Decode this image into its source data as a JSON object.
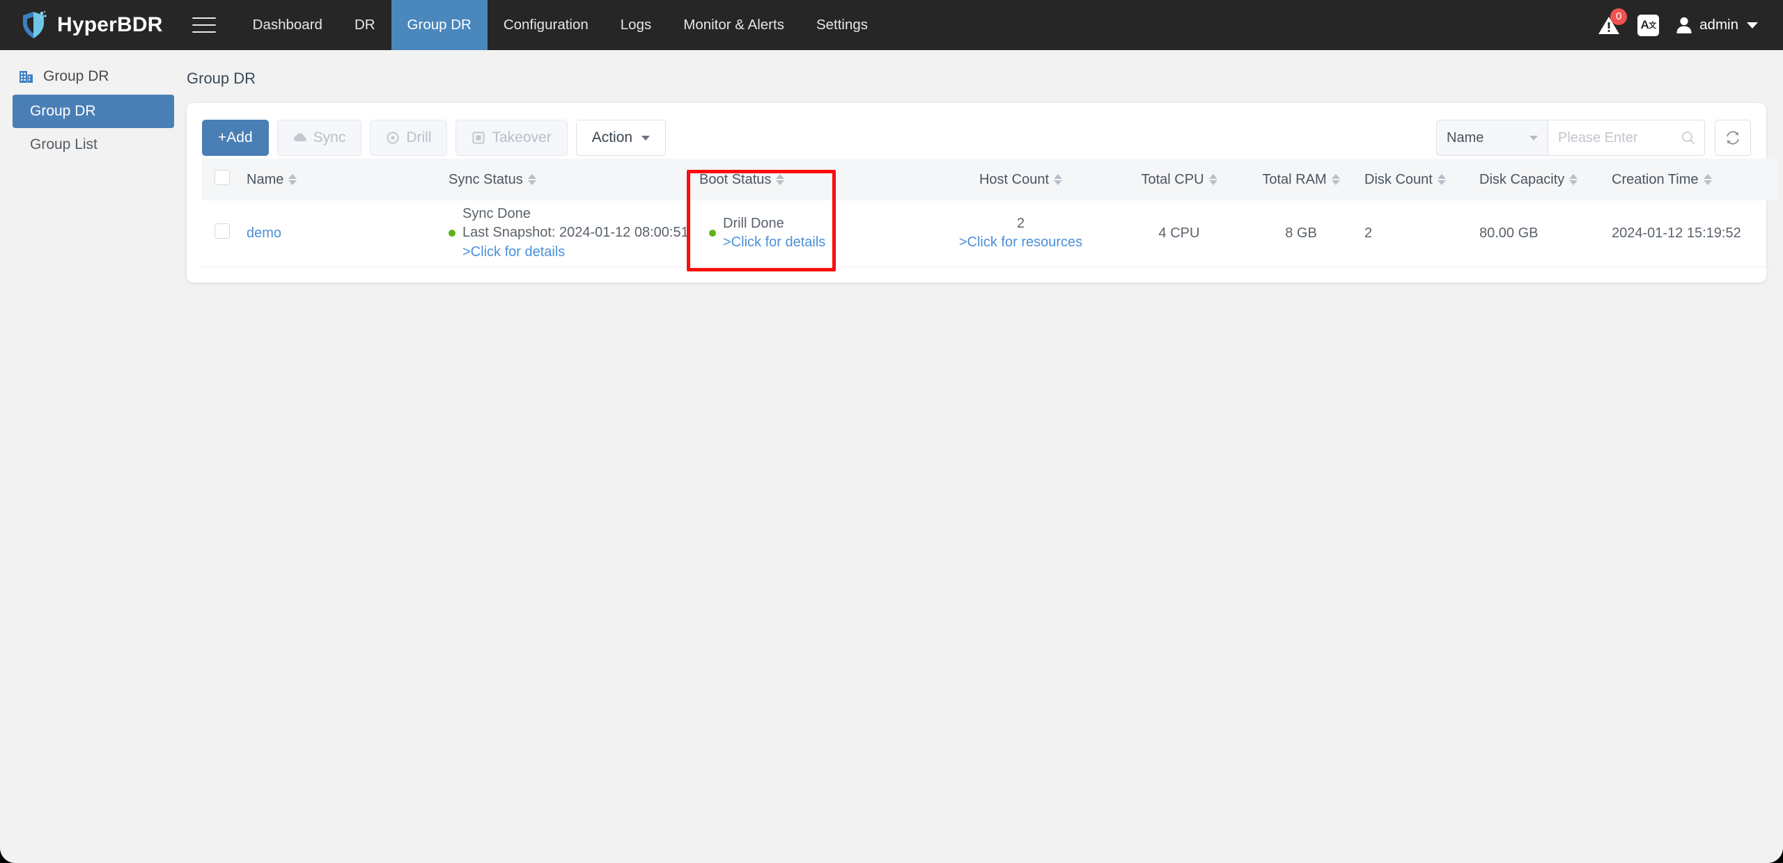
{
  "app": {
    "brand": "HyperBDR",
    "menu_icon": "hamburger-icon"
  },
  "topnav": {
    "items": [
      {
        "label": "Dashboard",
        "active": false
      },
      {
        "label": "DR",
        "active": false
      },
      {
        "label": "Group DR",
        "active": true
      },
      {
        "label": "Configuration",
        "active": false
      },
      {
        "label": "Logs",
        "active": false
      },
      {
        "label": "Monitor & Alerts",
        "active": false
      },
      {
        "label": "Settings",
        "active": false
      }
    ],
    "alert_badge": "0",
    "lang_label": "A",
    "lang_sup": "文",
    "user": "admin"
  },
  "sidebar": {
    "header": "Group DR",
    "items": [
      {
        "label": "Group DR",
        "active": true
      },
      {
        "label": "Group List",
        "active": false
      }
    ]
  },
  "main": {
    "page_title": "Group DR"
  },
  "toolbar": {
    "add_label": "+Add",
    "sync_label": "Sync",
    "drill_label": "Drill",
    "takeover_label": "Takeover",
    "action_label": "Action",
    "filter_field": "Name",
    "search_placeholder": "Please Enter",
    "search_value": ""
  },
  "table": {
    "columns": [
      {
        "label": "Name",
        "sortable": true
      },
      {
        "label": "Sync Status",
        "sortable": true
      },
      {
        "label": "Boot Status",
        "sortable": true
      },
      {
        "label": "Host Count",
        "sortable": true
      },
      {
        "label": "Total CPU",
        "sortable": true
      },
      {
        "label": "Total RAM",
        "sortable": true
      },
      {
        "label": "Disk Count",
        "sortable": true
      },
      {
        "label": "Disk Capacity",
        "sortable": true
      },
      {
        "label": "Creation Time",
        "sortable": true
      }
    ],
    "rows": [
      {
        "name": "demo",
        "sync_status_title": "Sync Done",
        "sync_status_detail": "Last Snapshot: 2024-01-12 08:00:51",
        "sync_status_link": ">Click for details",
        "boot_status_title": "Drill Done",
        "boot_status_link": ">Click for details",
        "host_count": "2",
        "host_count_link": ">Click for resources",
        "total_cpu": "4 CPU",
        "total_ram": "8 GB",
        "disk_count": "2",
        "disk_capacity": "80.00 GB",
        "creation_time": "2024-01-12 15:19:52"
      }
    ]
  },
  "annotation": {
    "highlight_color": "#fb0d0d",
    "highlight_target": "Boot Status"
  },
  "colors": {
    "nav_bg": "#262626",
    "accent": "#4a7fb5",
    "nav_active": "#4a87bd",
    "link": "#4a90d9",
    "status_ok": "#5fb319",
    "badge": "#ef5350"
  }
}
